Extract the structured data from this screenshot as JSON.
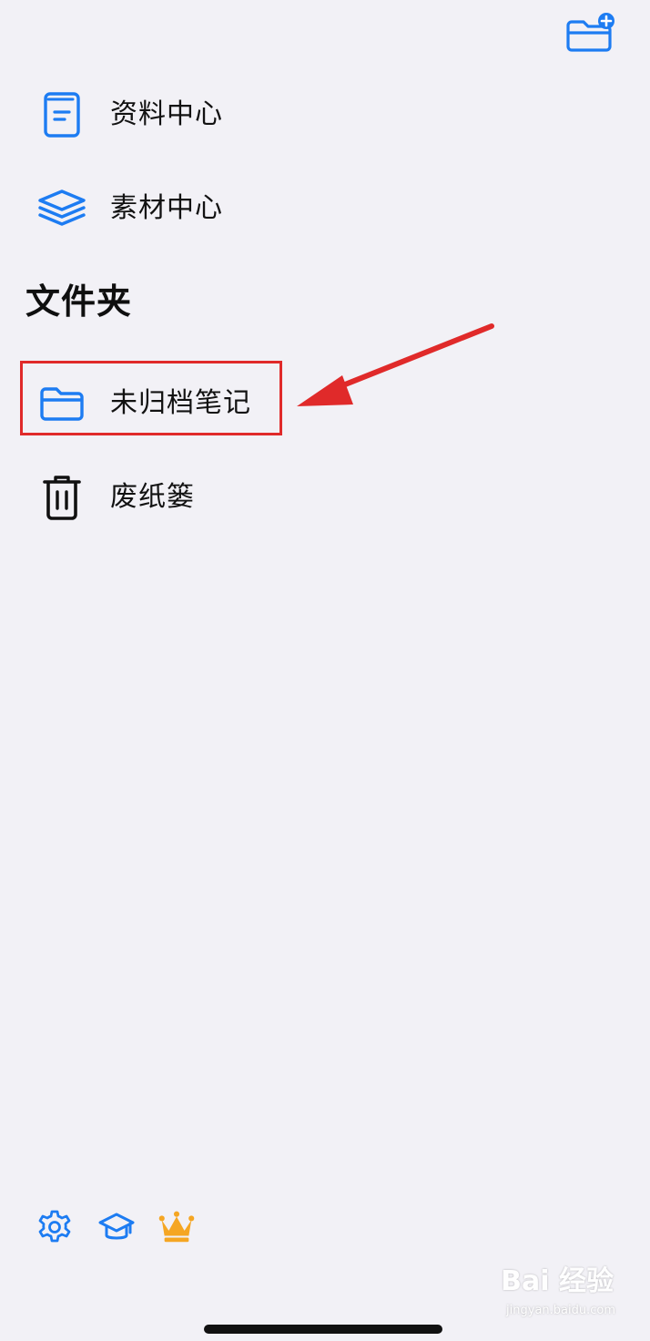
{
  "toolbar": {
    "new_folder_icon": "folder-plus-icon"
  },
  "library": {
    "items": [
      {
        "label": "资料中心",
        "icon": "book-icon"
      },
      {
        "label": "素材中心",
        "icon": "layers-icon"
      }
    ]
  },
  "folders": {
    "title": "文件夹",
    "items": [
      {
        "label": "未归档笔记",
        "icon": "folder-icon",
        "highlighted": true
      },
      {
        "label": "废纸篓",
        "icon": "trash-icon"
      }
    ]
  },
  "bottom_bar": {
    "icons": [
      "gear-icon",
      "graduation-cap-icon",
      "crown-icon"
    ]
  },
  "watermark": {
    "text": "Bai 经验",
    "sub": "jingyan.baidu.com"
  },
  "colors": {
    "accent": "#1d7cf2",
    "annotation": "#e02a2a",
    "crown": "#f5a623",
    "background": "#f2f1f6"
  }
}
